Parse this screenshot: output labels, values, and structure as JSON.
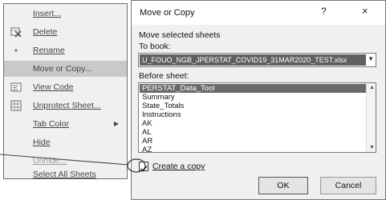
{
  "context_menu": {
    "items": [
      {
        "label": "Insert...",
        "icon": "",
        "disabled": false
      },
      {
        "label": "Delete",
        "icon": "delete-sheet-icon",
        "disabled": false
      },
      {
        "label": "Rename",
        "icon": "rename-icon",
        "disabled": false
      },
      {
        "label": "Move or Copy...",
        "icon": "",
        "disabled": false,
        "selected": true
      },
      {
        "label": "View Code",
        "icon": "view-code-icon",
        "disabled": false
      },
      {
        "label": "Unprotect Sheet...",
        "icon": "unprotect-sheet-icon",
        "disabled": false
      },
      {
        "label": "Tab Color",
        "icon": "",
        "disabled": false,
        "submenu": true
      },
      {
        "label": "Hide",
        "icon": "",
        "disabled": false
      },
      {
        "label": "Unhide...",
        "icon": "",
        "disabled": true
      },
      {
        "label": "Select All Sheets",
        "icon": "",
        "disabled": false
      }
    ]
  },
  "dialog": {
    "title": "Move or Copy",
    "help_glyph": "?",
    "close_glyph": "×",
    "move_selected_label": "Move selected sheets",
    "to_book_label": "To book:",
    "to_book_value": "U_FOUO_NGB_JPERSTAT_COVID19_31MAR2020_TEST.xlsx",
    "before_sheet_label": "Before sheet:",
    "sheets": [
      "PERSTAT_Data_Tool",
      "Summary",
      "State_Totals",
      "Instructions",
      "AK",
      "AL",
      "AR",
      "AZ"
    ],
    "selected_sheet": "PERSTAT_Data_Tool",
    "create_copy_label": "Create a copy",
    "create_copy_checked": true,
    "ok_label": "OK",
    "cancel_label": "Cancel"
  },
  "colors": {
    "menu_bg": "#f0f0f0",
    "selection_bg": "#c9c9c9",
    "list_selection_bg": "#6a6a6a"
  }
}
